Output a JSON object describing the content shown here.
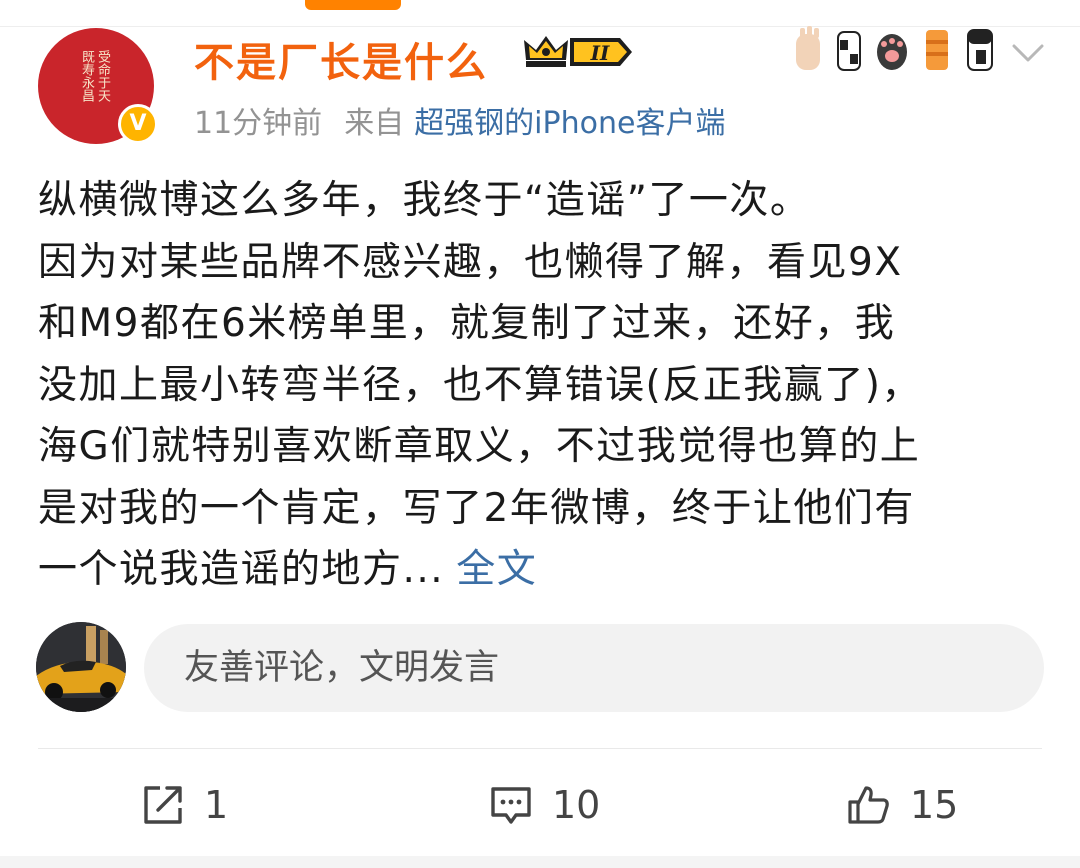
{
  "user": {
    "name": "不是厂长是什么",
    "avatar_text": [
      "受命于天",
      "既寿永昌"
    ],
    "verified_mark": "V",
    "level": "II"
  },
  "meta": {
    "time": "11分钟前",
    "source_prefix": "来自",
    "source": "超强钢的iPhone客户端"
  },
  "post": {
    "lines": [
      "纵横微博这么多年，我终于“造谣”了一次。",
      "因为对某些品牌不感兴趣，也懒得了解，看见9X",
      "和M9都在6米榜单里，就复制了过来，还好，我",
      "没加上最小转弯半径，也不算错误(反正我赢了)，",
      "海G们就特别喜欢断章取义，不过我觉得也算的上",
      "是对我的一个肯定，写了2年微博，终于让他们有",
      "一个说我造谣的地方..."
    ],
    "full_text_link": "全文"
  },
  "comment_box": {
    "placeholder": "友善评论，文明发言"
  },
  "actions": {
    "repost": {
      "icon": "share-icon",
      "count": "1"
    },
    "comment": {
      "icon": "comment-icon",
      "count": "10"
    },
    "like": {
      "icon": "thumbs-up-icon",
      "count": "15"
    }
  },
  "colors": {
    "accent": "#ff8200",
    "username": "#f2620e",
    "link": "#3b6ea5",
    "meta": "#939393"
  }
}
